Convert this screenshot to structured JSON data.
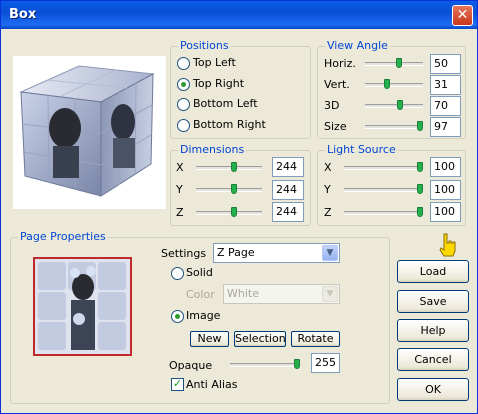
{
  "window": {
    "title": "Box"
  },
  "positions": {
    "title": "Positions",
    "options": [
      "Top Left",
      "Top Right",
      "Bottom Left",
      "Bottom Right"
    ],
    "selected": "Top Right"
  },
  "view_angle": {
    "title": "View Angle",
    "rows": [
      {
        "label": "Horiz.",
        "value": "50",
        "level": 0.5
      },
      {
        "label": "Vert.",
        "value": "31",
        "level": 0.31
      },
      {
        "label": "3D",
        "value": "70",
        "level": 0.7
      },
      {
        "label": "Size",
        "value": "97",
        "level": 0.97
      }
    ]
  },
  "dimensions": {
    "title": "Dimensions",
    "rows": [
      {
        "label": "X",
        "value": "244",
        "level": 0.5
      },
      {
        "label": "Y",
        "value": "244",
        "level": 0.5
      },
      {
        "label": "Z",
        "value": "244",
        "level": 0.5
      }
    ]
  },
  "light_source": {
    "title": "Light Source",
    "rows": [
      {
        "label": "X",
        "value": "100",
        "level": 1.0
      },
      {
        "label": "Y",
        "value": "100",
        "level": 1.0
      },
      {
        "label": "Z",
        "value": "100",
        "level": 1.0
      }
    ]
  },
  "page_properties": {
    "title": "Page Properties",
    "settings_label": "Settings",
    "settings_value": "Z Page",
    "solid_label": "Solid",
    "color_label": "Color",
    "color_value": "White",
    "image_label": "Image",
    "selected": "Image",
    "buttons": {
      "new": "New",
      "selection": "Selection",
      "rotate": "Rotate"
    },
    "opaque_label": "Opaque",
    "opaque_value": "255",
    "opaque_level": 1.0,
    "anti_alias_label": "Anti Alias",
    "anti_alias_checked": true
  },
  "buttons": {
    "load": "Load",
    "save": "Save",
    "help": "Help",
    "cancel": "Cancel",
    "ok": "OK"
  },
  "colors": {
    "accent": "#0046d5",
    "titlebar": "#0a5ce8",
    "slider_thumb": "#22b14c",
    "page_border": "#c0282e"
  },
  "icons": {
    "close": "close-icon",
    "pointer": "pointing-hand-icon",
    "dropdown": "chevron-down-icon"
  }
}
